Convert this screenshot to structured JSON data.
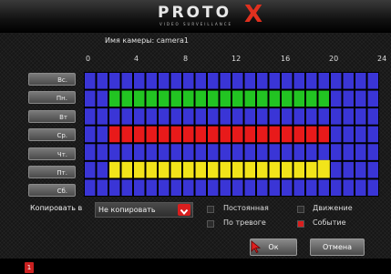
{
  "logo": {
    "main": "PROTO",
    "mark": "X",
    "sub": "VIDEO SURVEILLANCE"
  },
  "camera_label": "Имя камеры: camera1",
  "hours": [
    "0",
    "4",
    "8",
    "12",
    "16",
    "20",
    "24"
  ],
  "days": [
    "Вс.",
    "Пн.",
    "Вт",
    "Ср.",
    "Чт.",
    "Пт.",
    "Сб."
  ],
  "schedule": {
    "slots": 24,
    "colors": {
      "empty": "#3a35d6",
      "motion": "#22c422",
      "alarm": "#e81a1a",
      "event": "#f2e41a",
      "gridline": "#000000"
    },
    "rows": [
      [],
      [
        {
          "from": 2,
          "to": 20,
          "type": "motion"
        }
      ],
      [],
      [
        {
          "from": 2,
          "to": 20,
          "type": "alarm"
        }
      ],
      [],
      [
        {
          "from": 2,
          "to": 20,
          "type": "event"
        }
      ],
      []
    ]
  },
  "copy": {
    "label": "Копировать в",
    "value": "Не копировать"
  },
  "legend": {
    "continuous": {
      "label": "Постоянная",
      "color": "#2b2b2b"
    },
    "motion": {
      "label": "Движение",
      "color": "#2b2b2b"
    },
    "alarm": {
      "label": "По тревоге",
      "color": "#2b2b2b"
    },
    "event": {
      "label": "Событие",
      "color": "#d81e1e"
    }
  },
  "buttons": {
    "ok": "Ок",
    "cancel": "Отмена"
  },
  "bottom_badge": "1"
}
